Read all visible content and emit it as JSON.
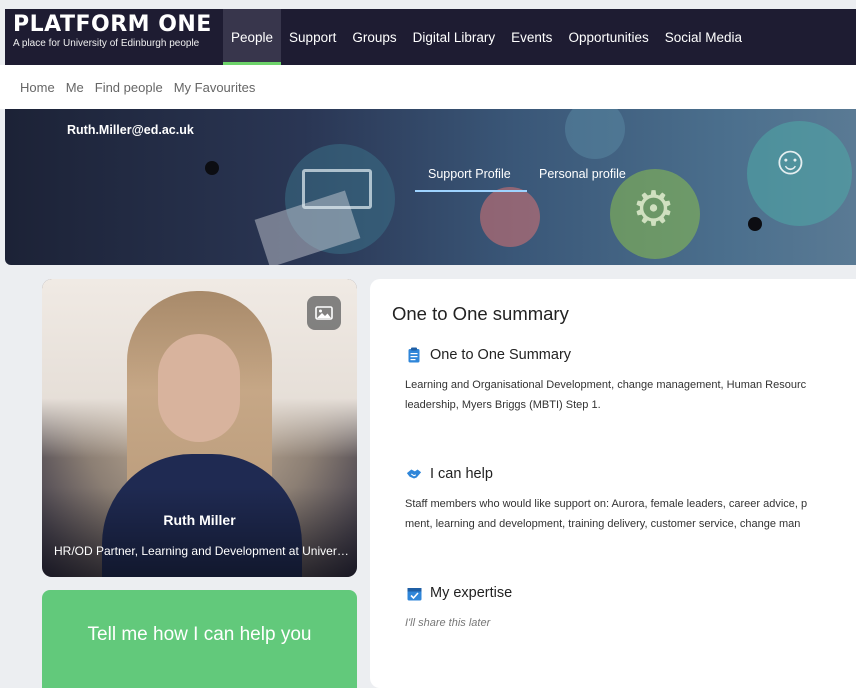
{
  "brand": {
    "title": "PLATFORM ONE",
    "subtitle": "A place for University of Edinburgh people"
  },
  "topnav": {
    "items": [
      {
        "label": "People",
        "active": true
      },
      {
        "label": "Support"
      },
      {
        "label": "Groups"
      },
      {
        "label": "Digital Library"
      },
      {
        "label": "Events"
      },
      {
        "label": "Opportunities"
      },
      {
        "label": "Social Media"
      }
    ]
  },
  "subnav": {
    "items": [
      "Home",
      "Me",
      "Find people",
      "My Favourites"
    ]
  },
  "banner": {
    "email": "Ruth.Miller@ed.ac.uk",
    "tabs": [
      {
        "label": "Support Profile",
        "active": true
      },
      {
        "label": "Personal profile"
      }
    ]
  },
  "profile": {
    "name": "Ruth Miller",
    "title": "HR/OD Partner, Learning and Development at University of Edinburgh"
  },
  "help_card": {
    "label": "Tell me how I can help you"
  },
  "summary": {
    "title": "One to One summary",
    "sections": [
      {
        "icon": "clipboard-icon",
        "heading": "One to One Summary",
        "lines": [
          "Learning and Organisational Development, change management, Human Resourc",
          "leadership, Myers Briggs (MBTI) Step 1."
        ]
      },
      {
        "icon": "handshake-icon",
        "heading": "I can help",
        "lines": [
          "Staff members who would like support on: Aurora, female leaders, career advice, p",
          "ment, learning and development, training delivery, customer service, change man"
        ]
      },
      {
        "icon": "calendar-check-icon",
        "heading": "My expertise",
        "lines": [
          "I'll share this later"
        ]
      }
    ]
  },
  "colors": {
    "nav_bg": "#1e1c32",
    "nav_active_underline": "#6dd36a",
    "help_card_bg": "#62c97b",
    "icon_blue": "#2f86d9"
  }
}
